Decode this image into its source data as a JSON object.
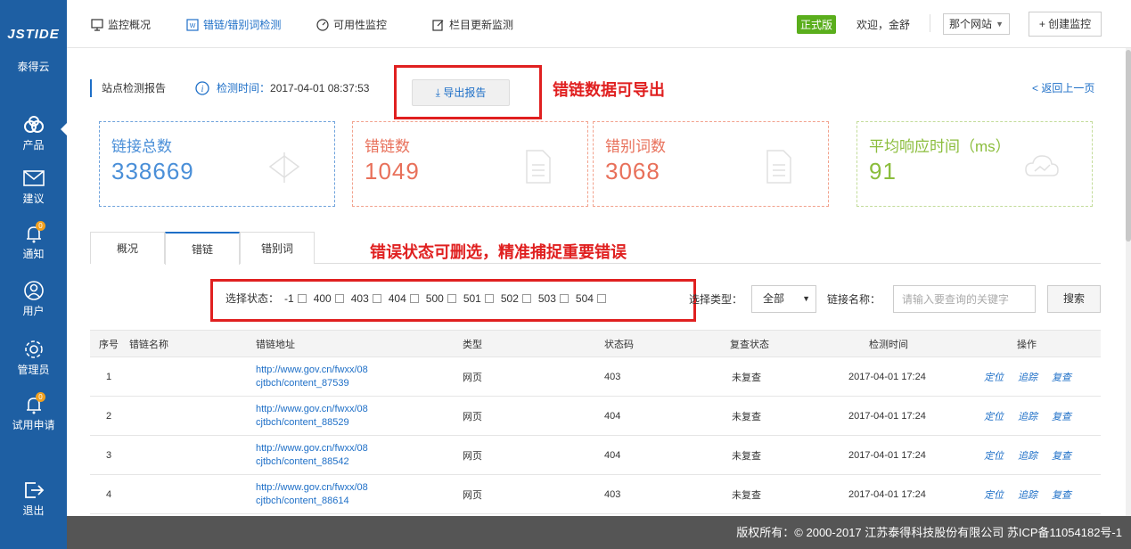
{
  "sidebar": {
    "logo": "JSTIDE",
    "brand": "泰得云",
    "items": [
      {
        "label": "产品",
        "icon": "product-icon"
      },
      {
        "label": "建议",
        "icon": "mail-icon"
      },
      {
        "label": "通知",
        "icon": "bell-icon",
        "badge": "0"
      },
      {
        "label": "用户",
        "icon": "user-icon"
      },
      {
        "label": "管理员",
        "icon": "gear-icon"
      },
      {
        "label": "试用申请",
        "icon": "bell-icon",
        "badge": "0"
      },
      {
        "label": "退出",
        "icon": "logout-icon"
      }
    ]
  },
  "topnav": {
    "items": [
      "监控概况",
      "错链/错别词检测",
      "可用性监控",
      "栏目更新监测"
    ],
    "version_badge": "正式版",
    "welcome": "欢迎，金舒",
    "site_select": "那个网站",
    "create_button": "+ 创建监控"
  },
  "report": {
    "title": "站点检测报告",
    "time_label": "检测时间：",
    "time_value": "2017-04-01 08:37:53",
    "export_button": "导出报告",
    "back_link": "< 返回上一页"
  },
  "annotations": {
    "export_note": "错链数据可导出",
    "filter_note": "错误状态可删选，精准捕捉重要错误"
  },
  "stats": [
    {
      "label": "链接总数",
      "value": "338669"
    },
    {
      "label": "错链数",
      "value": "1049"
    },
    {
      "label": "错别词数",
      "value": "3068"
    },
    {
      "label": "平均响应时间（ms）",
      "value": "91"
    }
  ],
  "tabs": [
    "概况",
    "错链",
    "错别词"
  ],
  "filter": {
    "status_label": "选择状态：",
    "statuses": [
      "-1",
      "400",
      "403",
      "404",
      "500",
      "501",
      "502",
      "503",
      "504"
    ],
    "type_label": "选择类型：",
    "type_value": "全部",
    "name_label": "链接名称：",
    "name_placeholder": "请输入要查询的关键字",
    "search_button": "搜索"
  },
  "table": {
    "headers": [
      "序号",
      "错链名称",
      "错链地址",
      "类型",
      "状态码",
      "复查状态",
      "检测时间",
      "操作"
    ],
    "rows": [
      {
        "no": "1",
        "url1": "http://www.gov.cn/fwxx/08",
        "url2": "cjtbch/content_87539",
        "type": "网页",
        "code": "403",
        "status": "未复查",
        "time": "2017-04-01 17:24"
      },
      {
        "no": "2",
        "url1": "http://www.gov.cn/fwxx/08",
        "url2": "cjtbch/content_88529",
        "type": "网页",
        "code": "404",
        "status": "未复查",
        "time": "2017-04-01 17:24"
      },
      {
        "no": "3",
        "url1": "http://www.gov.cn/fwxx/08",
        "url2": "cjtbch/content_88542",
        "type": "网页",
        "code": "404",
        "status": "未复查",
        "time": "2017-04-01 17:24"
      },
      {
        "no": "4",
        "url1": "http://www.gov.cn/fwxx/08",
        "url2": "cjtbch/content_88614",
        "type": "网页",
        "code": "403",
        "status": "未复查",
        "time": "2017-04-01 17:24"
      }
    ],
    "ops": [
      "定位",
      "追踪",
      "复查"
    ]
  },
  "footer": "版权所有：© 2000-2017 江苏泰得科技股份有限公司   苏ICP备11054182号-1",
  "colors": {
    "sidebar": "#1e5fa3",
    "accent": "#1e6fc7",
    "annotation": "#e02020",
    "version": "#5aae1c"
  }
}
